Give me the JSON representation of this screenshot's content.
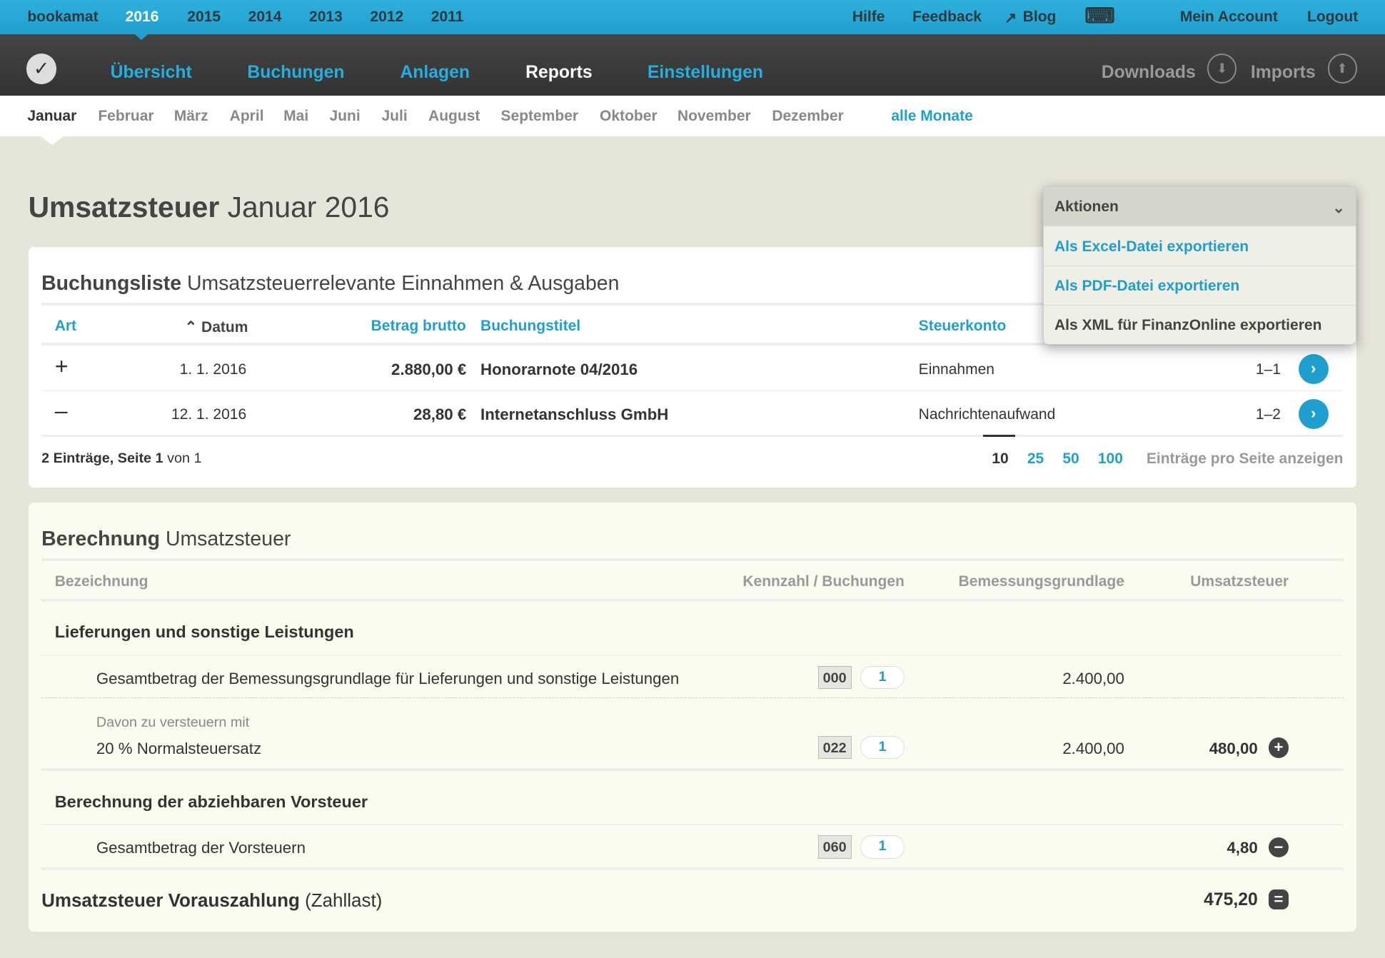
{
  "topbar": {
    "brand": "bookamat",
    "years": [
      "2016",
      "2015",
      "2014",
      "2013",
      "2012",
      "2011"
    ],
    "links": [
      "Hilfe",
      "Feedback",
      "Blog",
      "Mein Account",
      "Logout"
    ],
    "blog_icon": "arrow-up-right-icon",
    "keyboard_icon": "keyboard-icon"
  },
  "nav": {
    "items": [
      "Übersicht",
      "Buchungen",
      "Anlagen",
      "Reports",
      "Einstellungen"
    ],
    "active": "Reports",
    "downloads": "Downloads",
    "imports": "Imports"
  },
  "months": {
    "items": [
      "Januar",
      "Februar",
      "März",
      "April",
      "Mai",
      "Juni",
      "Juli",
      "August",
      "September",
      "Oktober",
      "November",
      "Dezember"
    ],
    "all": "alle Monate",
    "active": "Januar"
  },
  "page": {
    "title_bold": "Umsatzsteuer",
    "title_rest": "Januar 2016"
  },
  "actions": {
    "label": "Aktionen",
    "items": [
      "Als Excel-Datei exportieren",
      "Als PDF-Datei exportieren",
      "Als XML für FinanzOnline exportieren"
    ]
  },
  "list": {
    "title_bold": "Buchungsliste",
    "title_rest": "Umsatzsteuerrelevante Einnahmen & Ausgaben",
    "columns": {
      "art": "Art",
      "datum": "Datum",
      "betrag": "Betrag brutto",
      "titel": "Buchungstitel",
      "konto": "Steuerkonto"
    },
    "rows": [
      {
        "art": "+",
        "datum": "1. 1. 2016",
        "betrag": "2.880,00 €",
        "titel": "Honorarnote 04/2016",
        "konto": "Einnahmen",
        "nr": "1–1"
      },
      {
        "art": "–",
        "datum": "12. 1. 2016",
        "betrag": "28,80 €",
        "titel": "Internetanschluss GmbH",
        "konto": "Nachrichtenaufwand",
        "nr": "1–2"
      }
    ],
    "summary_a": "2 Einträge, Seite",
    "summary_b": "1",
    "summary_c": "von 1",
    "page_sizes": [
      "10",
      "25",
      "50",
      "100"
    ],
    "page_size_active": "10",
    "page_size_label": "Einträge pro Seite anzeigen"
  },
  "calc": {
    "title_bold": "Berechnung",
    "title_rest": "Umsatzsteuer",
    "columns": {
      "bez": "Bezeichnung",
      "kz": "Kennzahl / Buchungen",
      "bem": "Bemessungsgrundlage",
      "ust": "Umsatzsteuer"
    },
    "sec1": "Lieferungen und sonstige Leistungen",
    "r1": {
      "label": "Gesamtbetrag der Bemessungsgrundlage für Lieferungen und sonstige Leistungen",
      "kz": "000",
      "count": "1",
      "bem": "2.400,00"
    },
    "r2": {
      "sub": "Davon zu versteuern mit",
      "label": "20 % Normalsteuersatz",
      "kz": "022",
      "count": "1",
      "bem": "2.400,00",
      "ust": "480,00"
    },
    "sec2": "Berechnung der abziehbaren Vorsteuer",
    "r3": {
      "label": "Gesamtbetrag der Vorsteuern",
      "kz": "060",
      "count": "1",
      "ust": "4,80"
    },
    "total": {
      "bold": "Umsatzsteuer Vorauszahlung",
      "rest": "(Zahllast)",
      "value": "475,20"
    }
  },
  "colors": {
    "accent": "#1e9fd0",
    "topbar": "#25a8d8",
    "nav": "#3a3a3a",
    "background": "#e6e5da"
  }
}
